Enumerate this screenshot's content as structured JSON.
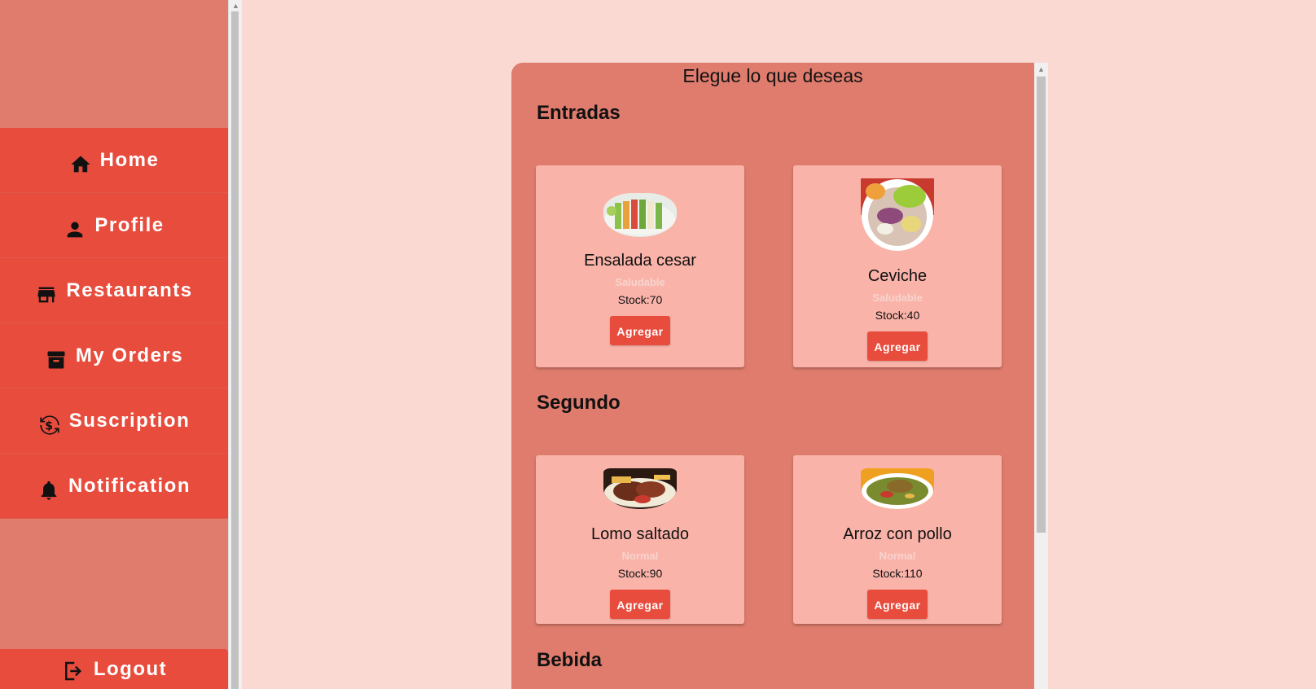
{
  "sidebar": {
    "items": [
      {
        "label": "Home",
        "icon": "home-icon"
      },
      {
        "label": "Profile",
        "icon": "person-icon"
      },
      {
        "label": "Restaurants",
        "icon": "store-icon"
      },
      {
        "label": "My Orders",
        "icon": "archive-icon"
      },
      {
        "label": "Suscription",
        "icon": "currency-exchange-icon"
      },
      {
        "label": "Notification",
        "icon": "bell-icon"
      }
    ],
    "logout_label": "Logout"
  },
  "menu": {
    "title": "Elegue lo que deseas",
    "sections": [
      {
        "title": "Entradas",
        "items": [
          {
            "name": "Ensalada cesar",
            "tag": "Saludable",
            "stock": "Stock:70",
            "button": "Agregar"
          },
          {
            "name": "Ceviche",
            "tag": "Saludable",
            "stock": "Stock:40",
            "button": "Agregar"
          }
        ]
      },
      {
        "title": "Segundo",
        "items": [
          {
            "name": "Lomo saltado",
            "tag": "Normal",
            "stock": "Stock:90",
            "button": "Agregar"
          },
          {
            "name": "Arroz con pollo",
            "tag": "Normal",
            "stock": "Stock:110",
            "button": "Agregar"
          }
        ]
      },
      {
        "title": "Bebida",
        "items": []
      }
    ]
  },
  "colors": {
    "page_bg": "#fad9d3",
    "sidebar_bg": "#df7c6d",
    "accent": "#e84c3d",
    "card_bg": "#fab3a9"
  }
}
